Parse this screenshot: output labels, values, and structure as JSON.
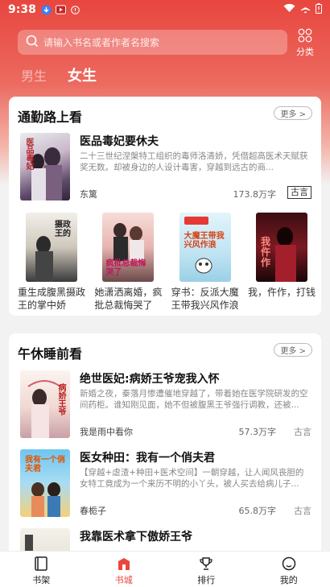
{
  "status_bar": {
    "time": "9:38"
  },
  "search": {
    "placeholder": "请输入书名或者作者名搜索"
  },
  "category": {
    "label": "分类"
  },
  "gender_tabs": {
    "male": "男生",
    "female": "女生"
  },
  "section_commute": {
    "title": "通勤路上看",
    "more": "更多 >",
    "featured": {
      "title": "医品毒妃要休夫",
      "desc": "二十三世纪涅槃特工组织的毒师洛清娇，凭借超高医术天赋获奖无数。却被身边的人设计毒害，穿越到远古的商...",
      "author": "东篱",
      "words": "173.8万字",
      "tag": "古言",
      "cover_text": "医品毒妃"
    },
    "grid": [
      {
        "title": "重生成腹黑摄政王的掌中娇",
        "cover_text": "摄政王的"
      },
      {
        "title": "她潇洒离婚，疯批总裁悔哭了",
        "cover_text": "疯批总裁悔哭了"
      },
      {
        "title": "穿书：反派大魔王带我兴风作浪",
        "cover_text": "大魔王带我兴风作浪"
      },
      {
        "title": "我，仵作，打钱",
        "cover_text": "我仵作"
      }
    ]
  },
  "section_nap": {
    "title": "午休睡前看",
    "more": "更多 >",
    "books": [
      {
        "title": "绝世医妃:病娇王爷宠我入怀",
        "desc": "新婚之夜，秦落月惨遭催地穿越了，带着她在医学院研发的空间药柜。谁知刚见面，她不但被腹黑王爷强行调教，还被...",
        "author": "我是雨中看你",
        "words": "57.3万字",
        "tag": "古言",
        "cover_text": "病娇王爷"
      },
      {
        "title": "医女种田：我有一个俏夫君",
        "desc": "【穿越+虐渣+种田+医术空间】一朝穿越，让人闻风丧胆的女特工竟成为一个来历不明的小丫头，被人买去给病儿子...",
        "author": "春栀子",
        "words": "65.8万字",
        "tag": "古言",
        "cover_text": "我有一个俏夫君"
      },
      {
        "title": "我靠医术拿下傲娇王爷",
        "desc": "",
        "author": "",
        "words": "",
        "tag": "",
        "cover_text": ""
      }
    ]
  },
  "bottom_nav": [
    {
      "label": "书架",
      "icon": "bookshelf-icon"
    },
    {
      "label": "书城",
      "icon": "bookstore-icon"
    },
    {
      "label": "排行",
      "icon": "trophy-icon"
    },
    {
      "label": "我的",
      "icon": "profile-icon"
    }
  ],
  "colors": {
    "accent": "#e8463f",
    "tag_text": "#333333"
  }
}
